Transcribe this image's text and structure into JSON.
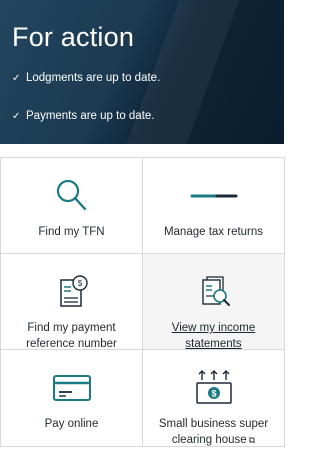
{
  "banner": {
    "title": "For action",
    "statuses": [
      {
        "tick": "✓",
        "text": "Lodgments are up to date."
      },
      {
        "tick": "✓",
        "text": "Payments are up to date."
      }
    ]
  },
  "tiles": [
    {
      "label": "Find my TFN",
      "icon": "magnifier-icon"
    },
    {
      "label": "Manage tax returns",
      "icon": "loading-bar-icon"
    },
    {
      "label": "Find my payment reference number",
      "icon": "payment-document-icon"
    },
    {
      "label": "View my income statements",
      "icon": "income-statement-search-icon"
    },
    {
      "label": "Pay online",
      "icon": "credit-card-icon"
    },
    {
      "label": "Small business super clearing house",
      "icon": "banknote-arrows-icon",
      "external": "⧉"
    }
  ],
  "colors": {
    "accent": "#1a7a84",
    "banner": "#0f2538",
    "text": "#1f2a36"
  }
}
